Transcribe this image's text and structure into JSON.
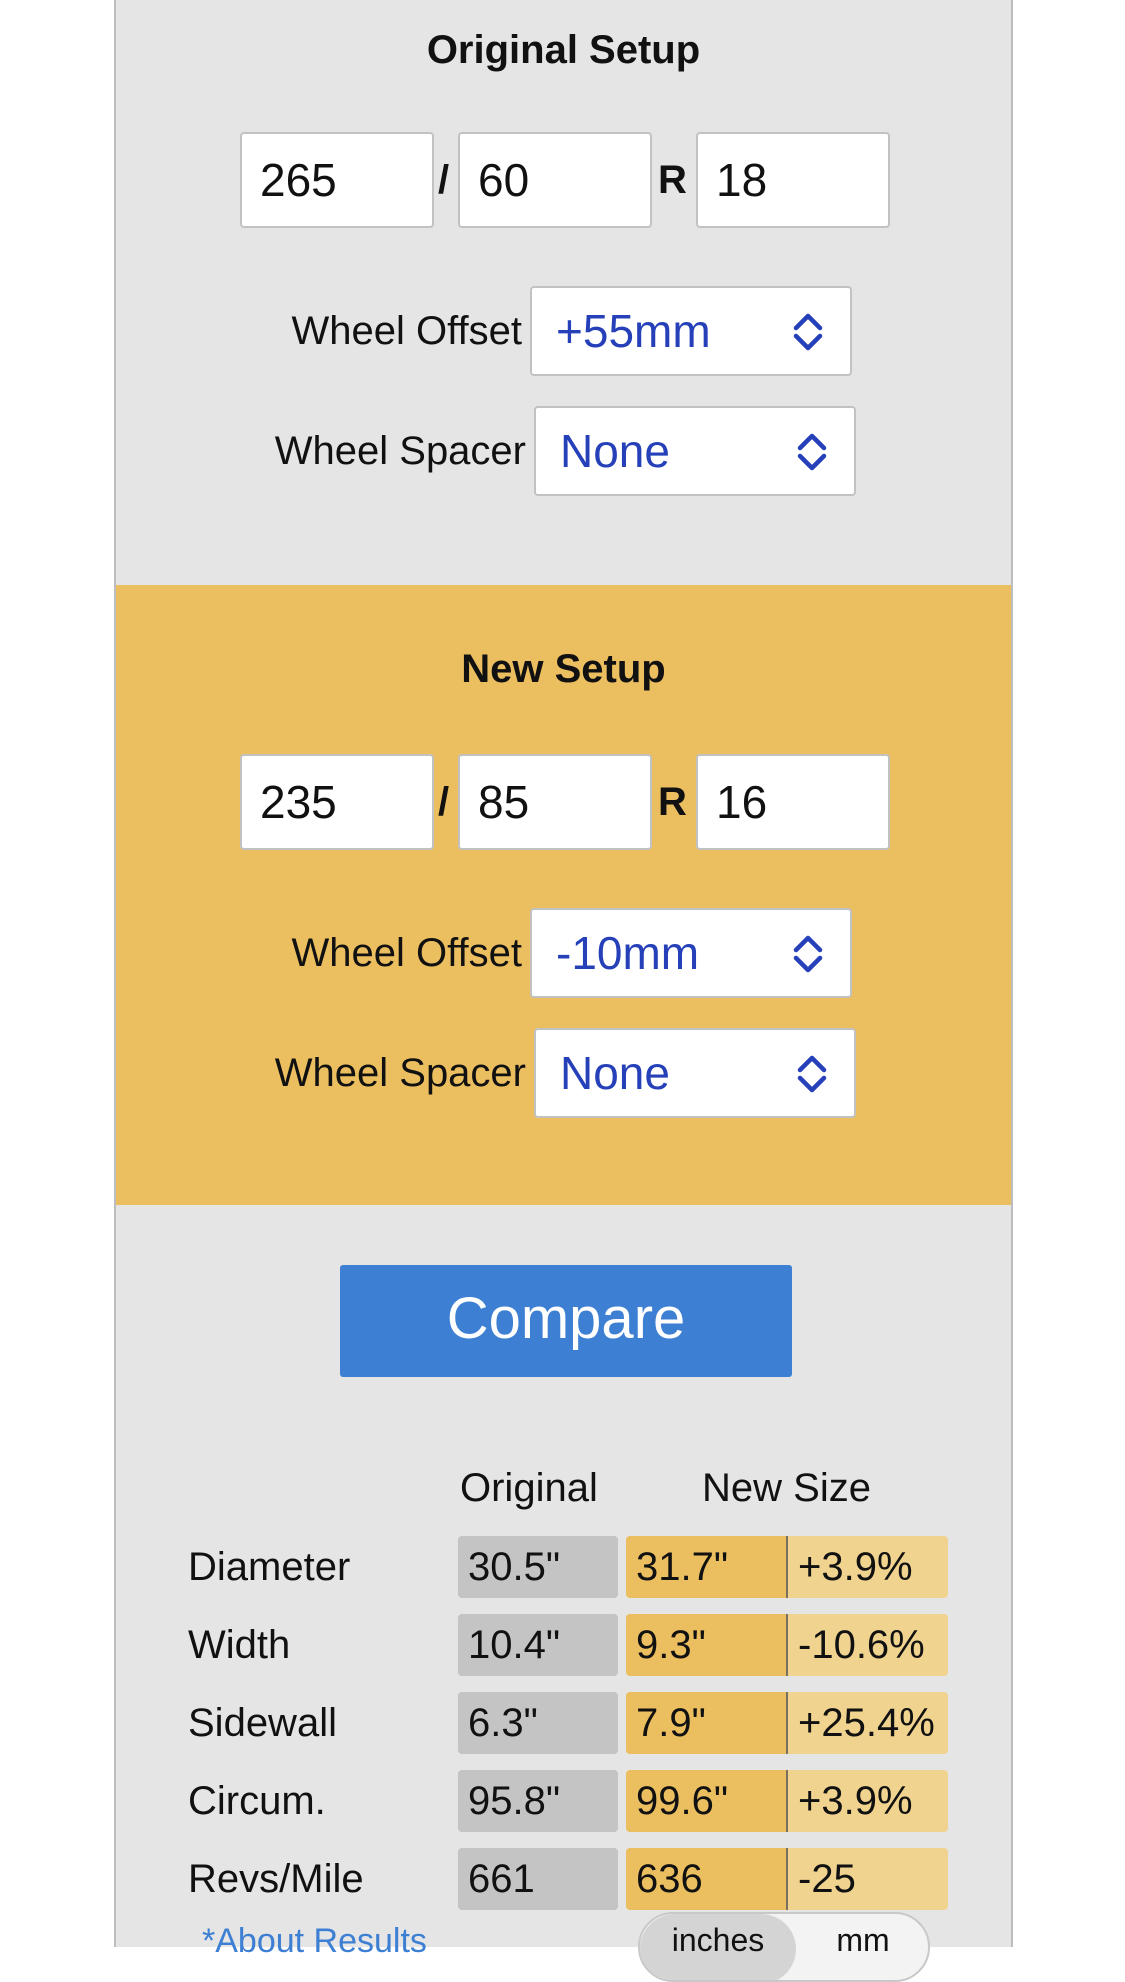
{
  "original": {
    "title": "Original Setup",
    "width": "265",
    "aspect": "60",
    "rim": "18",
    "slash": "/",
    "r": "R",
    "offset_label": "Wheel Offset",
    "offset_value": "+55mm",
    "spacer_label": "Wheel Spacer",
    "spacer_value": "None"
  },
  "new": {
    "title": "New Setup",
    "width": "235",
    "aspect": "85",
    "rim": "16",
    "slash": "/",
    "r": "R",
    "offset_label": "Wheel Offset",
    "offset_value": "-10mm",
    "spacer_label": "Wheel Spacer",
    "spacer_value": "None"
  },
  "compare_label": "Compare",
  "results": {
    "header_original": "Original",
    "header_new": "New Size",
    "rows": [
      {
        "label": "Diameter",
        "original": "30.5\"",
        "new": "31.7\"",
        "diff": "+3.9%"
      },
      {
        "label": "Width",
        "original": "10.4\"",
        "new": "9.3\"",
        "diff": "-10.6%"
      },
      {
        "label": "Sidewall",
        "original": "6.3\"",
        "new": "7.9\"",
        "diff": "+25.4%"
      },
      {
        "label": "Circum.",
        "original": "95.8\"",
        "new": "99.6\"",
        "diff": "+3.9%"
      },
      {
        "label": "Revs/Mile",
        "original": "661",
        "new": "636",
        "diff": "-25"
      }
    ]
  },
  "about_link": "*About Results",
  "units": {
    "inches": "inches",
    "mm": "mm",
    "selected": "inches"
  },
  "colors": {
    "accent_blue": "#3d7fd2",
    "new_section": "#ebbf60",
    "select_text": "#2540b8"
  },
  "icons": {
    "select": "chevron-up-down-icon"
  }
}
